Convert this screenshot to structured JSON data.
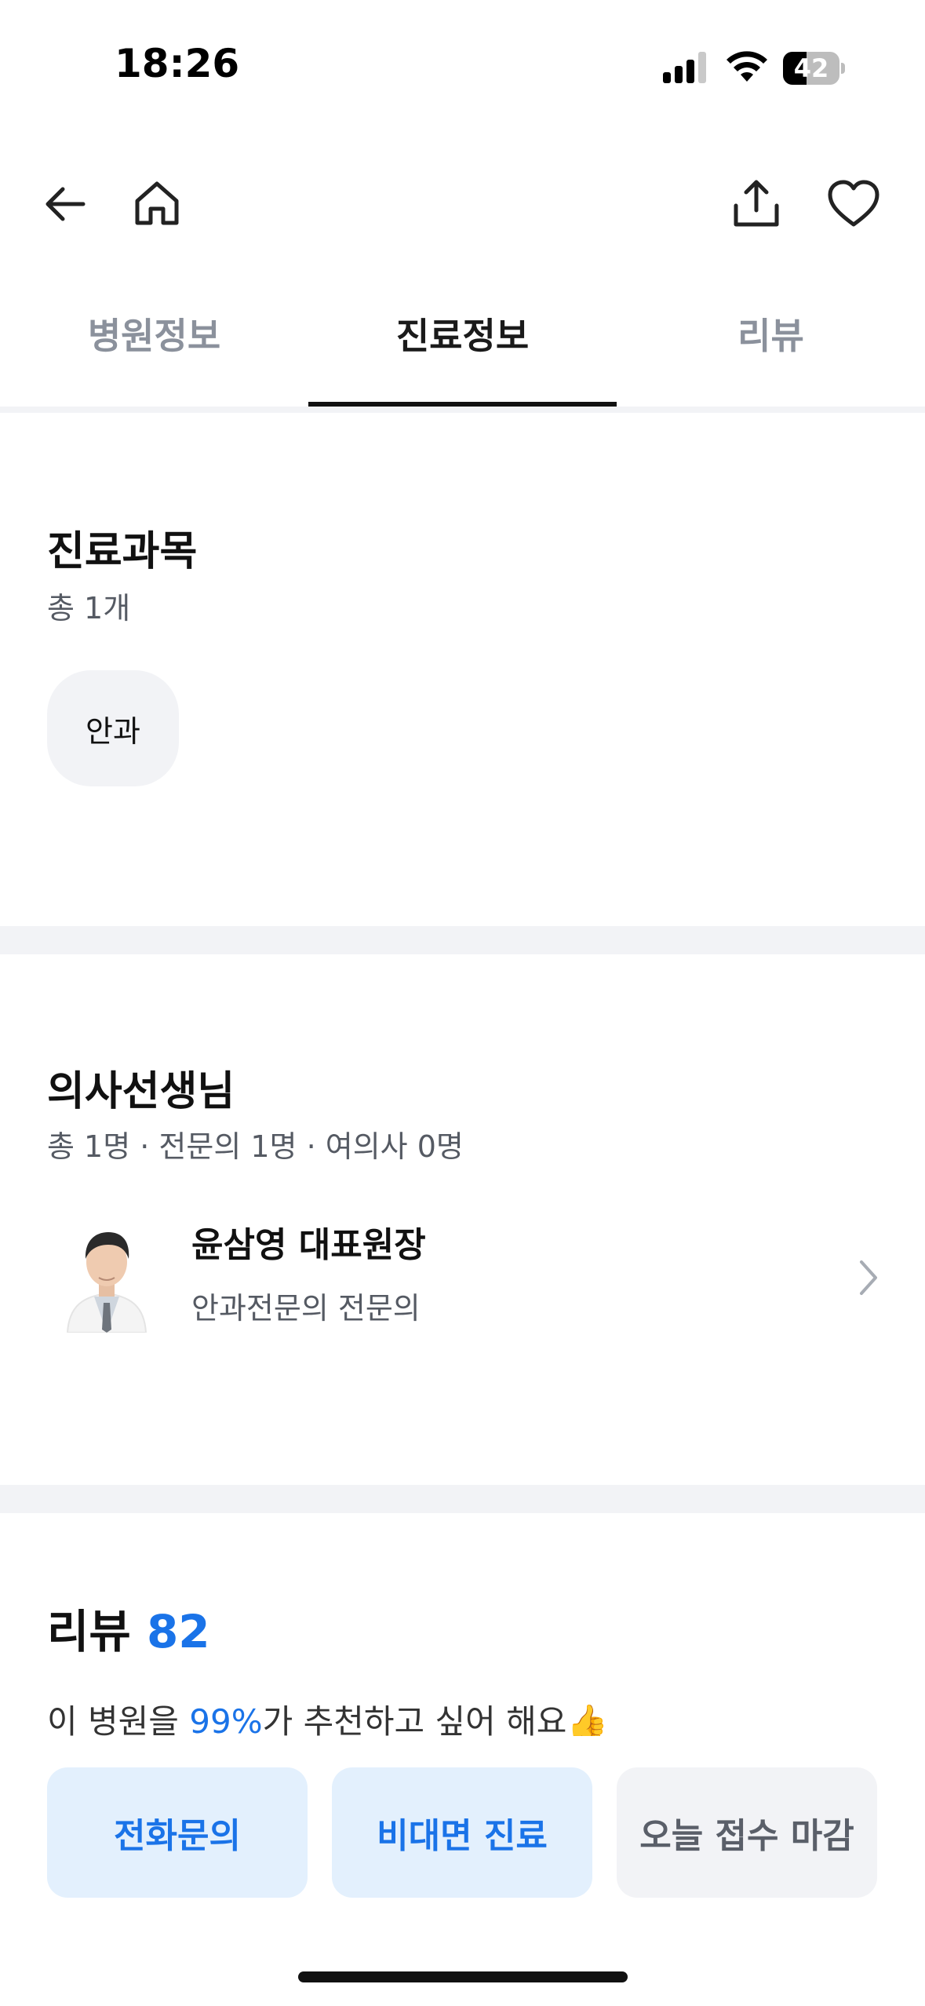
{
  "status_bar": {
    "time": "18:26",
    "battery": "42",
    "battery_level": 0.42
  },
  "nav": {
    "back_icon": "arrow-left-icon",
    "home_icon": "home-icon",
    "share_icon": "share-icon",
    "favorite_icon": "heart-icon"
  },
  "tabs": [
    {
      "label": "병원정보",
      "active": false
    },
    {
      "label": "진료정보",
      "active": true
    },
    {
      "label": "리뷰",
      "active": false
    }
  ],
  "departments": {
    "title": "진료과목",
    "count": "총 1개",
    "items": [
      "안과"
    ]
  },
  "doctors": {
    "title": "의사선생님",
    "summary": "총 1명 · 전문의 1명 · 여의사 0명",
    "list": [
      {
        "name": "윤삼영 대표원장",
        "role": "안과전문의 전문의"
      }
    ]
  },
  "reviews": {
    "title": "리뷰",
    "count": "82",
    "summary_prefix": "이 병원을 ",
    "summary_percent": "99%",
    "summary_suffix": "가 추천하고 싶어 해요",
    "summary_emoji": "👍"
  },
  "actions": {
    "call": "전화문의",
    "remote": "비대면 진료",
    "closed": "오늘 접수 마감"
  },
  "colors": {
    "accent": "#1a73e8",
    "accent_bg": "#e3f0fd",
    "muted_bg": "#f2f3f6"
  }
}
